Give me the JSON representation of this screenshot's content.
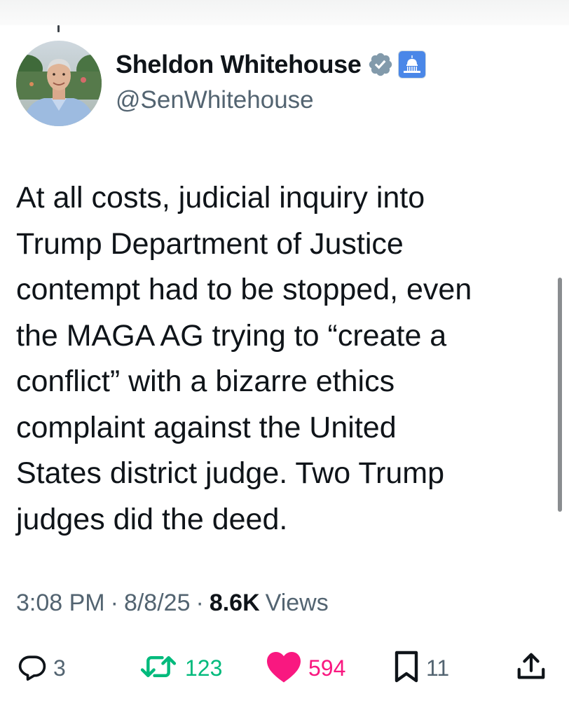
{
  "author": {
    "display_name": "Sheldon Whitehouse",
    "handle": "@SenWhitehouse",
    "verified_badge_icon": "verified-badge-icon",
    "affiliate_badge_icon": "capitol-icon",
    "verified_color": "#829aab",
    "affiliate_color": "#4a87e8"
  },
  "tweet": {
    "text": "At all costs, judicial inquiry into\nTrump Department of Justice\ncontempt had to be stopped, even\nthe MAGA AG trying to “create a\nconflict” with a bizarre ethics\ncomplaint against the United\nStates district judge. Two Trump\njudges did the deed."
  },
  "meta": {
    "time": "3:08 PM",
    "separator": "·",
    "date": "8/8/25",
    "views_count": "8.6K",
    "views_label": "Views"
  },
  "actions": {
    "reply": {
      "icon": "reply-icon",
      "count": "3"
    },
    "retweet": {
      "icon": "retweet-icon",
      "count": "123",
      "color": "#00ba7c"
    },
    "like": {
      "icon": "heart-icon",
      "count": "594",
      "color": "#f91880"
    },
    "bookmark": {
      "icon": "bookmark-icon",
      "count": "11"
    },
    "share": {
      "icon": "share-icon"
    }
  }
}
